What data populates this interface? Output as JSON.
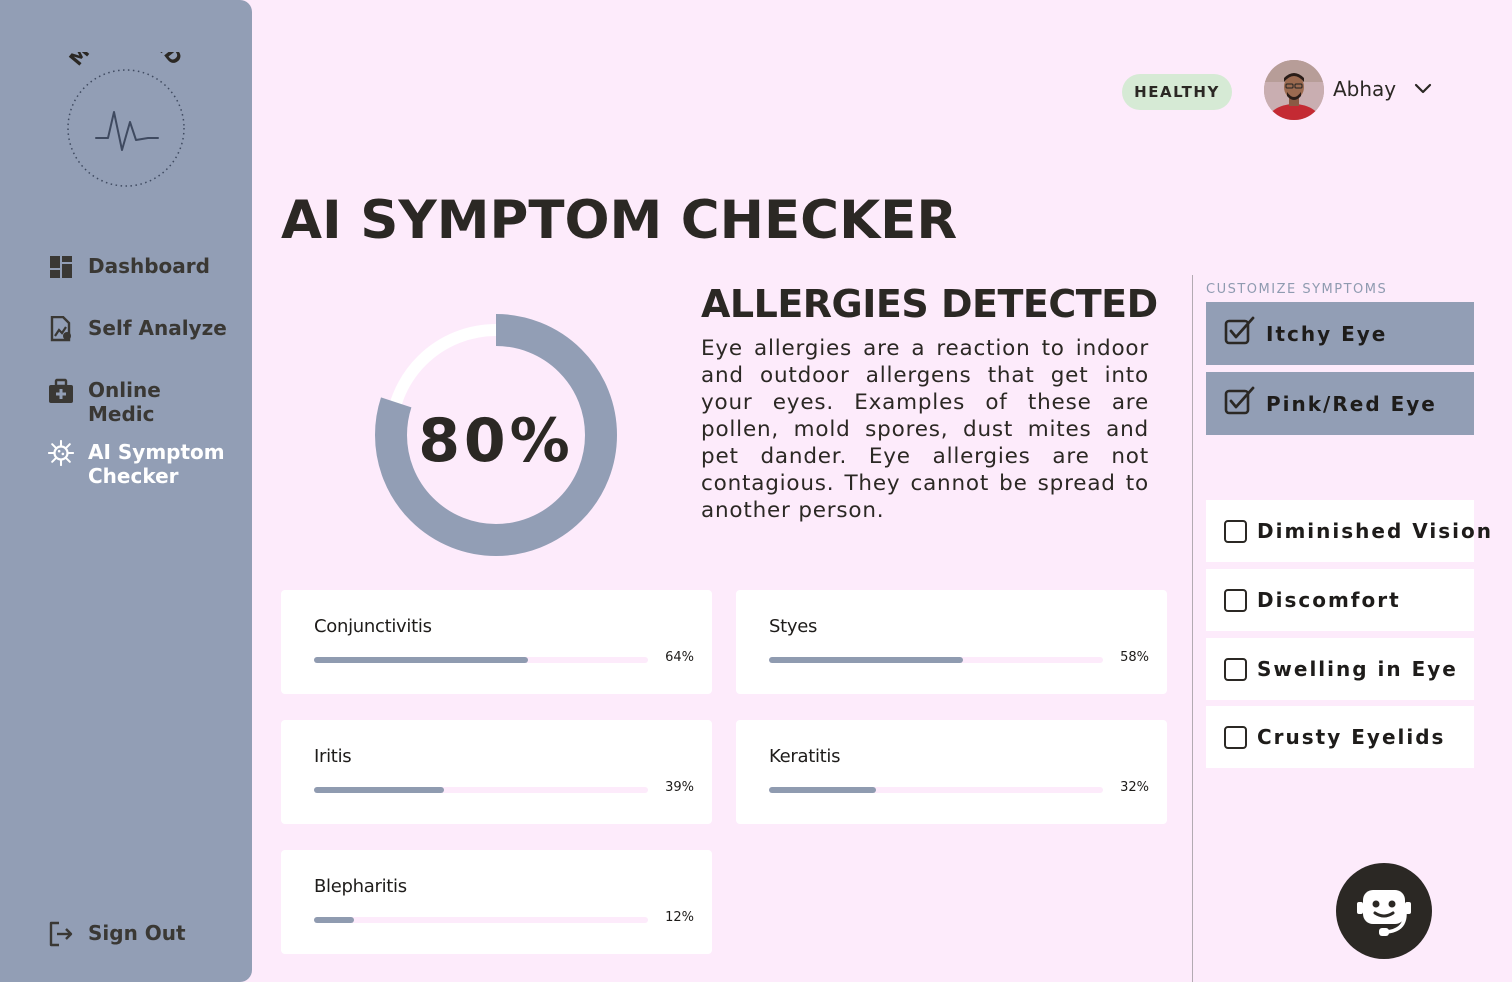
{
  "brand": {
    "name": "MEDHEAD",
    "logo_icon": "heartbeat-icon"
  },
  "sidebar": {
    "items": [
      {
        "label": "Dashboard",
        "icon": "dashboard-icon"
      },
      {
        "label": "Self Analyze",
        "icon": "document-chart-icon"
      },
      {
        "label": "Online Medic",
        "icon": "medical-kit-icon"
      },
      {
        "label": "AI Symptom Checker",
        "icon": "virus-icon",
        "active": true
      }
    ],
    "signout": {
      "label": "Sign Out",
      "icon": "sign-out-icon"
    }
  },
  "header": {
    "status_badge": "HEALTHY",
    "user_name": "Abhay"
  },
  "page": {
    "title": "AI SYMPTOM CHECKER"
  },
  "result": {
    "percent": 80,
    "percent_label": "80%",
    "title": "ALLERGIES DETECTED",
    "description": "Eye allergies are a reaction to indoor and outdoor allergens that get into your eyes. Examples of these are pollen, mold spores, dust mites and pet dander. Eye allergies are not contagious. They cannot be spread to another person."
  },
  "conditions": [
    {
      "name": "Conjunctivitis",
      "percent": 64,
      "label": "64%"
    },
    {
      "name": "Styes",
      "percent": 58,
      "label": "58%"
    },
    {
      "name": "Iritis",
      "percent": 39,
      "label": "39%"
    },
    {
      "name": "Keratitis",
      "percent": 32,
      "label": "32%"
    },
    {
      "name": "Blepharitis",
      "percent": 12,
      "label": "12%"
    }
  ],
  "symptoms": {
    "heading": "CUSTOMIZE SYMPTOMS",
    "selected": [
      {
        "label": "Itchy Eye",
        "checked": true
      },
      {
        "label": "Pink/Red Eye",
        "checked": true
      }
    ],
    "available": [
      {
        "label": "Diminished Vision",
        "checked": false
      },
      {
        "label": "Discomfort",
        "checked": false
      },
      {
        "label": "Swelling in Eye",
        "checked": false
      },
      {
        "label": "Crusty Eyelids",
        "checked": false
      }
    ]
  },
  "chat": {
    "icon": "chatbot-icon"
  },
  "colors": {
    "background": "#fdebfb",
    "sidebar": "#929eb5",
    "accent": "#8f9bb0",
    "badge": "#d6ead5",
    "dark": "#2b2824"
  }
}
